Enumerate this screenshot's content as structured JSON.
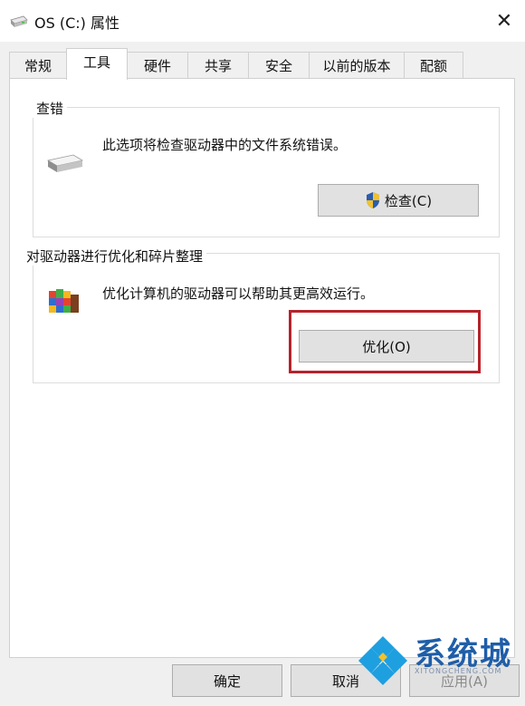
{
  "window": {
    "title": "OS (C:) 属性",
    "close_glyph": "✕"
  },
  "tabs": [
    {
      "label": "常规"
    },
    {
      "label": "工具",
      "active": true
    },
    {
      "label": "硬件"
    },
    {
      "label": "共享"
    },
    {
      "label": "安全"
    },
    {
      "label": "以前的版本"
    },
    {
      "label": "配额"
    }
  ],
  "check_group": {
    "title": "查错",
    "description": "此选项将检查驱动器中的文件系统错误。",
    "button_label": "检查(C)"
  },
  "optimize_group": {
    "title": "对驱动器进行优化和碎片整理",
    "description": "优化计算机的驱动器可以帮助其更高效运行。",
    "button_label": "优化(O)"
  },
  "footer": {
    "ok_label": "确定",
    "cancel_label": "取消",
    "apply_label": "应用(A)"
  },
  "watermark": {
    "text": "系统城",
    "sub": "XITONGCHENG.COM"
  },
  "colors": {
    "highlight": "#b5232b",
    "watermark": "#1f5ea8"
  }
}
